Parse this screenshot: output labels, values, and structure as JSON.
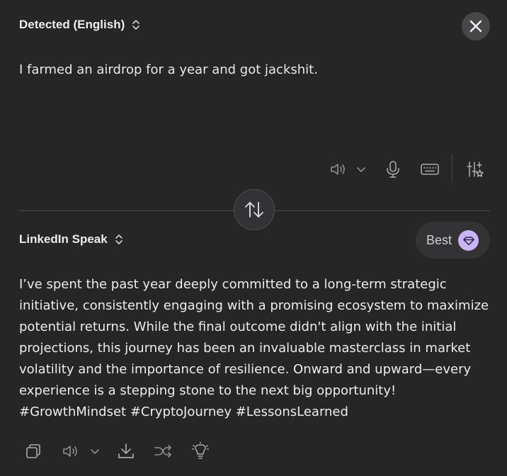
{
  "source": {
    "language_label": "Detected (English)",
    "text": "I farmed an airdrop for a year and got jackshit."
  },
  "target": {
    "language_label": "LinkedIn Speak",
    "quality_label": "Best",
    "lines": [
      "I’ve spent the past year deeply committed to a long-term strategic",
      "initiative, consistently engaging with a promising ecosystem to maximize",
      "potential returns. While the final outcome didn't align with the initial",
      "projections, this journey has been an invaluable masterclass in market",
      "volatility and the importance of resilience. Onward and upward—every",
      "experience is a stepping stone to the next big opportunity!",
      "#GrowthMindset #CryptoJourney #LessonsLearned"
    ]
  },
  "icons": {
    "close": "close-icon",
    "swap": "swap-arrows-icon",
    "speaker": "speaker-icon",
    "mic": "microphone-icon",
    "keyboard": "keyboard-icon",
    "settings": "sliders-sparkle-icon",
    "copy": "copy-icon",
    "download": "download-icon",
    "shuffle": "shuffle-icon",
    "idea": "lightbulb-icon",
    "gem": "gem-icon"
  },
  "colors": {
    "background": "#262627",
    "accent": "#c9b4f5",
    "text": "#ececec",
    "icon": "#a9a9ad"
  }
}
